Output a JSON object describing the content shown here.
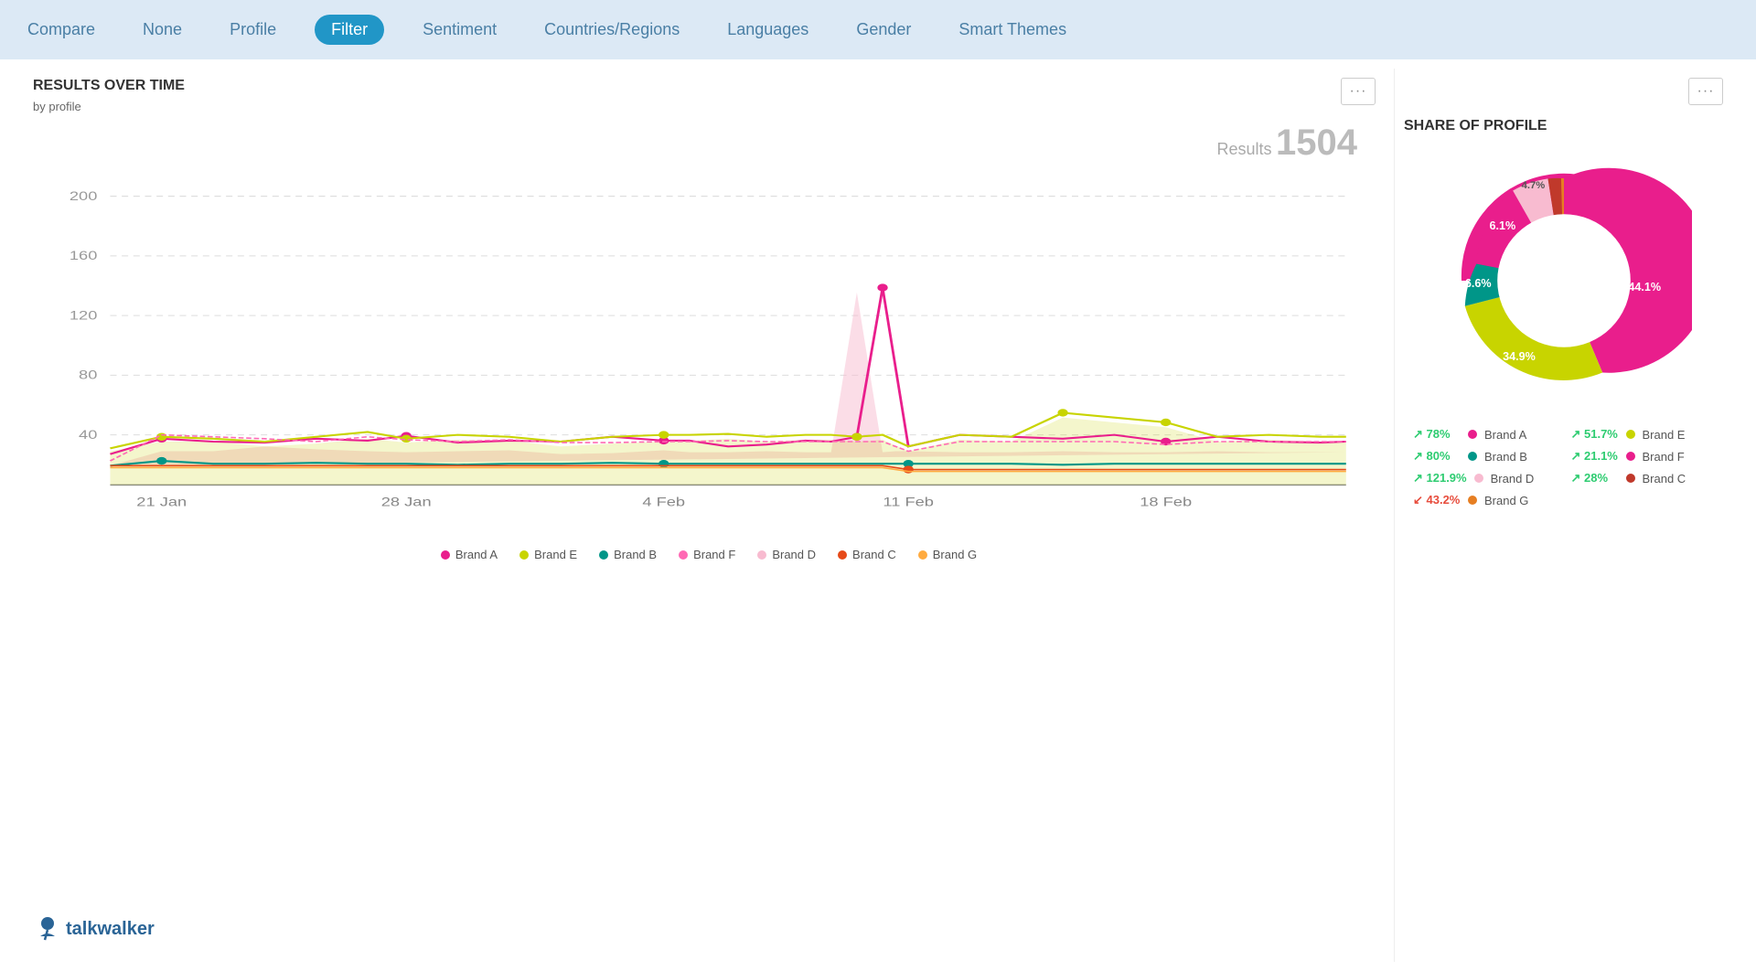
{
  "nav": {
    "items": [
      {
        "id": "compare",
        "label": "Compare",
        "active": false
      },
      {
        "id": "none",
        "label": "None",
        "active": false
      },
      {
        "id": "profile",
        "label": "Profile",
        "active": false
      },
      {
        "id": "filter",
        "label": "Filter",
        "active": true
      },
      {
        "id": "sentiment",
        "label": "Sentiment",
        "active": false
      },
      {
        "id": "countries",
        "label": "Countries/Regions",
        "active": false
      },
      {
        "id": "languages",
        "label": "Languages",
        "active": false
      },
      {
        "id": "gender",
        "label": "Gender",
        "active": false
      },
      {
        "id": "smart_themes",
        "label": "Smart Themes",
        "active": false
      }
    ]
  },
  "left_panel": {
    "title": "RESULTS OVER TIME",
    "subtitle": "by profile",
    "results_label": "Results",
    "results_number": "1504",
    "more_btn": "···",
    "y_axis": [
      "200",
      "160",
      "120",
      "80",
      "40"
    ],
    "x_axis": [
      "21 Jan",
      "28 Jan",
      "4 Feb",
      "11 Feb",
      "18 Feb"
    ],
    "legend": [
      {
        "label": "Brand A",
        "color": "#e91e8c"
      },
      {
        "label": "Brand E",
        "color": "#c8d400"
      },
      {
        "label": "Brand B",
        "color": "#009688"
      },
      {
        "label": "Brand F",
        "color": "#e91e8c"
      },
      {
        "label": "Brand D",
        "color": "#f8bbd0"
      },
      {
        "label": "Brand C",
        "color": "#e64a19"
      },
      {
        "label": "Brand G",
        "color": "#ffab40"
      }
    ]
  },
  "right_panel": {
    "title": "SHARE OF PROFILE",
    "more_btn": "···",
    "donut_segments": [
      {
        "label": "Brand A",
        "pct": 44.1,
        "color": "#e91e8c",
        "startAngle": 0,
        "endAngle": 158.76
      },
      {
        "label": "Brand E",
        "pct": 34.9,
        "color": "#c8d400",
        "startAngle": 158.76,
        "endAngle": 284.28
      },
      {
        "label": "Brand B",
        "pct": 6.6,
        "color": "#009688",
        "startAngle": 284.28,
        "endAngle": 308.04
      },
      {
        "label": "Brand F",
        "pct": 6.1,
        "color": "#e91e8c",
        "startAngle": 308.04,
        "endAngle": 329.96
      },
      {
        "label": "Brand D",
        "pct": 4.7,
        "color": "#f8bbd0",
        "startAngle": 329.96,
        "endAngle": 346.88
      },
      {
        "label": "Brand C",
        "pct": 2.4,
        "color": "#c0392b",
        "startAngle": 346.88,
        "endAngle": 355.52
      },
      {
        "label": "Brand G",
        "pct": 1.2,
        "color": "#e67e22",
        "startAngle": 355.52,
        "endAngle": 360
      }
    ],
    "legend": [
      {
        "pct": "78%",
        "trend": "up",
        "color": "#e91e8c",
        "brand": "Brand A"
      },
      {
        "pct": "51.7%",
        "trend": "up",
        "color": "#c8d400",
        "brand": "Brand E"
      },
      {
        "pct": "80%",
        "trend": "up",
        "color": "#009688",
        "brand": "Brand B"
      },
      {
        "pct": "21.1%",
        "trend": "up",
        "color": "#e91e8c",
        "brand": "Brand F"
      },
      {
        "pct": "121.9%",
        "trend": "up",
        "color": "#f8bbd0",
        "brand": "Brand D"
      },
      {
        "pct": "28%",
        "trend": "up",
        "color": "#c0392b",
        "brand": "Brand C"
      },
      {
        "pct": "43.2%",
        "trend": "down",
        "color": "#e67e22",
        "brand": "Brand G"
      }
    ]
  },
  "logo": {
    "text": "talkwalker"
  }
}
